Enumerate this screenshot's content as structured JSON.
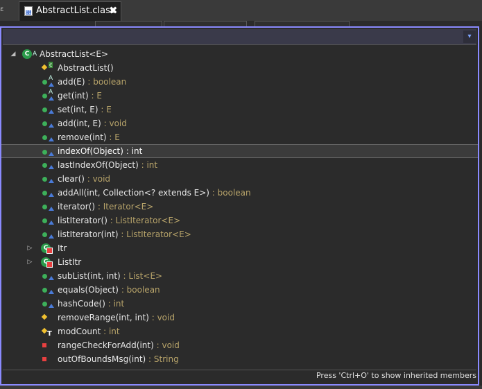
{
  "editor": {
    "tab_title": "AbstractList.class",
    "tab_close": "✖",
    "tab_left_glyph": "ε"
  },
  "outline": {
    "filter_value": "",
    "dropdown_glyph": "▾",
    "root": {
      "name": "AbstractList<E>",
      "expanded_glyph": "◢"
    },
    "members": [
      {
        "name": "AbstractList()",
        "type": "",
        "icon": "constructor-icon"
      },
      {
        "name": "add(E)",
        "type": " : boolean",
        "icon": "public-abstract-method-icon"
      },
      {
        "name": "get(int)",
        "type": " : E",
        "icon": "public-abstract-method-icon"
      },
      {
        "name": "set(int, E)",
        "type": " : E",
        "icon": "public-method-icon"
      },
      {
        "name": "add(int, E)",
        "type": " : void",
        "icon": "public-method-icon"
      },
      {
        "name": "remove(int)",
        "type": " : E",
        "icon": "public-method-icon"
      },
      {
        "name": "indexOf(Object)",
        "type": " : int",
        "icon": "public-method-icon",
        "selected": true
      },
      {
        "name": "lastIndexOf(Object)",
        "type": " : int",
        "icon": "public-method-icon"
      },
      {
        "name": "clear()",
        "type": " : void",
        "icon": "public-method-icon"
      },
      {
        "name": "addAll(int, Collection<? extends E>)",
        "type": " : boolean",
        "icon": "public-method-icon"
      },
      {
        "name": "iterator()",
        "type": " : Iterator<E>",
        "icon": "public-method-icon"
      },
      {
        "name": "listIterator()",
        "type": " : ListIterator<E>",
        "icon": "public-method-icon"
      },
      {
        "name": "listIterator(int)",
        "type": " : ListIterator<E>",
        "icon": "public-method-icon"
      },
      {
        "name": "Itr",
        "type": "",
        "icon": "private-inner-class-icon",
        "collapsed_glyph": "▷"
      },
      {
        "name": "ListItr",
        "type": "",
        "icon": "private-inner-class-icon",
        "collapsed_glyph": "▷"
      },
      {
        "name": "subList(int, int)",
        "type": " : List<E>",
        "icon": "public-method-icon"
      },
      {
        "name": "equals(Object)",
        "type": " : boolean",
        "icon": "public-method-icon"
      },
      {
        "name": "hashCode()",
        "type": " : int",
        "icon": "public-method-icon"
      },
      {
        "name": "removeRange(int, int)",
        "type": " : void",
        "icon": "protected-method-icon"
      },
      {
        "name": "modCount",
        "type": " : int",
        "icon": "protected-transient-field-icon"
      },
      {
        "name": "rangeCheckForAdd(int)",
        "type": " : void",
        "icon": "private-method-icon"
      },
      {
        "name": "outOfBoundsMsg(int)",
        "type": " : String",
        "icon": "private-method-icon"
      }
    ],
    "status_hint": "Press 'Ctrl+O' to show inherited members"
  }
}
